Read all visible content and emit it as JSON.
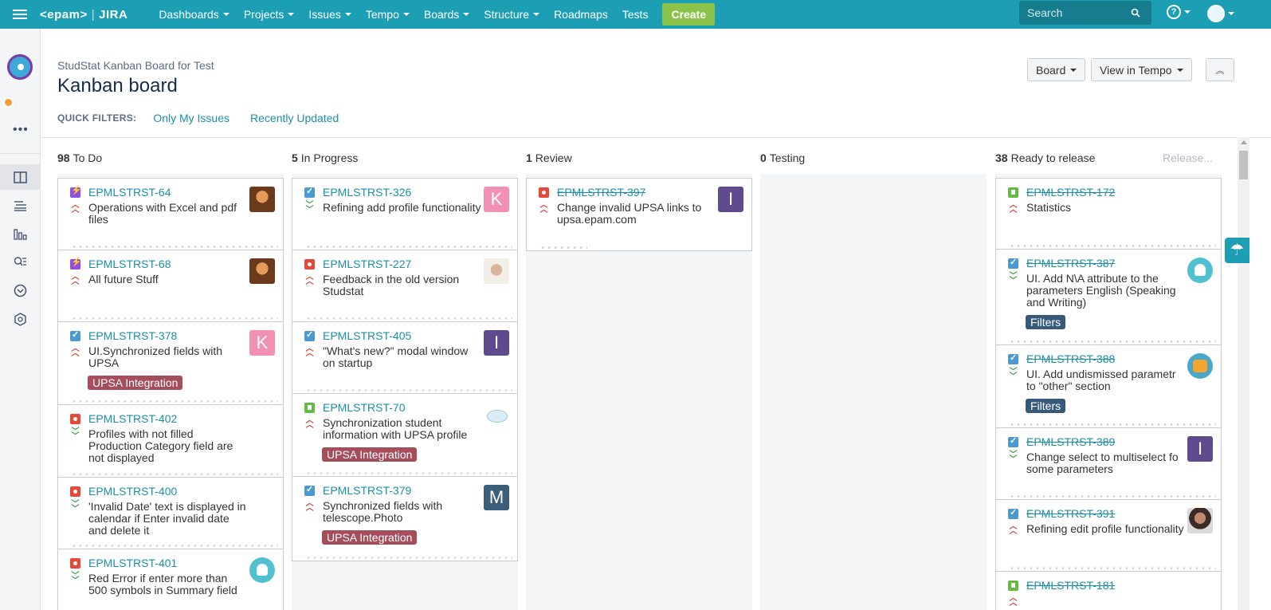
{
  "nav": {
    "logo_brand": "<epam>",
    "logo_sep": "|",
    "logo_product": "JIRA",
    "items": [
      {
        "label": "Dashboards",
        "caret": true
      },
      {
        "label": "Projects",
        "caret": true
      },
      {
        "label": "Issues",
        "caret": true
      },
      {
        "label": "Tempo",
        "caret": true
      },
      {
        "label": "Boards",
        "caret": true
      },
      {
        "label": "Structure",
        "caret": true
      },
      {
        "label": "Roadmaps",
        "caret": false
      },
      {
        "label": "Tests",
        "caret": false
      }
    ],
    "create_label": "Create",
    "search_placeholder": "Search",
    "help_label": "?"
  },
  "sidebar": {
    "more_label": "•••",
    "icons": [
      "board-icon",
      "backlog-icon",
      "reports-icon",
      "issues-search-icon",
      "releases-icon",
      "components-icon"
    ],
    "expand_label": "»"
  },
  "header": {
    "project_name": "StudStat Kanban Board for Test",
    "title": "Kanban board",
    "quick_filters_label": "QUICK FILTERS:",
    "quick_filters": [
      "Only My Issues",
      "Recently Updated"
    ],
    "board_button": "Board",
    "tempo_button": "View in Tempo",
    "collapse_label": "︽"
  },
  "columns": [
    {
      "count": "98",
      "name": "To Do"
    },
    {
      "count": "5",
      "name": "In Progress"
    },
    {
      "count": "1",
      "name": "Review"
    },
    {
      "count": "0",
      "name": "Testing"
    },
    {
      "count": "38",
      "name": "Ready to release"
    }
  ],
  "release_label": "Release...",
  "cards": {
    "todo": [
      {
        "type": "epic",
        "key": "EPMLSTRST-64",
        "prio": "high",
        "summary": "Operations with Excel and pdf files",
        "avatar": "photo1",
        "avatar_text": ""
      },
      {
        "type": "epic",
        "key": "EPMLSTRST-68",
        "prio": "high",
        "summary": "All future Stuff",
        "avatar": "photo1",
        "avatar_text": ""
      },
      {
        "type": "task",
        "key": "EPMLSTRST-378",
        "prio": "high",
        "summary": "UI.Synchronized fields with UPSA",
        "avatar": "k",
        "avatar_text": "K",
        "label": "UPSA Integration"
      },
      {
        "type": "bug",
        "key": "EPMLSTRST-402",
        "prio": "low",
        "summary": "Profiles with not filled Production Category field are not displayed",
        "avatar": "",
        "avatar_text": ""
      },
      {
        "type": "bug",
        "key": "EPMLSTRST-400",
        "prio": "low",
        "summary": "'Invalid Date' text is displayed in calendar if Enter invalid date and delete it",
        "avatar": "",
        "avatar_text": ""
      },
      {
        "type": "bug",
        "key": "EPMLSTRST-401",
        "prio": "low",
        "summary": "Red Error if enter more than 500 symbols in Summary field",
        "avatar": "round",
        "avatar_text": ""
      }
    ],
    "progress": [
      {
        "type": "task",
        "key": "EPMLSTRST-326",
        "prio": "low",
        "summary": "Refining add profile functionality",
        "avatar": "k",
        "avatar_text": "K"
      },
      {
        "type": "bug",
        "key": "EPMLSTRST-227",
        "prio": "high",
        "summary": "Feedback in the old version Studstat",
        "avatar": "photo2",
        "avatar_text": ""
      },
      {
        "type": "task",
        "key": "EPMLSTRST-405",
        "prio": "high",
        "summary": "\"What's new?\" modal window on startup",
        "avatar": "i",
        "avatar_text": "I"
      },
      {
        "type": "story",
        "key": "EPMLSTRST-70",
        "prio": "high",
        "summary": "Synchronization student information with UPSA profile",
        "avatar": "fish",
        "avatar_text": "",
        "label": "UPSA Integration"
      },
      {
        "type": "task",
        "key": "EPMLSTRST-379",
        "prio": "high",
        "summary": "Synchronized fields with telescope.Photo",
        "avatar": "m",
        "avatar_text": "M",
        "label": "UPSA Integration"
      }
    ],
    "review": [
      {
        "type": "bug",
        "key": "EPMLSTRST-397",
        "prio": "high",
        "summary": "Change invalid UPSA links to upsa.epam.com",
        "avatar": "i",
        "avatar_text": "I",
        "done": true
      }
    ],
    "release": [
      {
        "type": "story",
        "key": "EPMLSTRST-172",
        "prio": "high",
        "summary": "Statistics",
        "avatar": "",
        "avatar_text": "",
        "done": true
      },
      {
        "type": "task",
        "key": "EPMLSTRST-387",
        "prio": "low",
        "summary": "UI. Add N\\A attribute to the parameters English (Speaking and Writing)",
        "avatar": "round",
        "avatar_text": "",
        "done": true,
        "label": "Filters"
      },
      {
        "type": "task",
        "key": "EPMLSTRST-388",
        "prio": "low",
        "summary": "UI. Add undismissed parametr to \"other\" section",
        "avatar": "cat",
        "avatar_text": "",
        "done": true,
        "label": "Filters"
      },
      {
        "type": "task",
        "key": "EPMLSTRST-389",
        "prio": "low",
        "summary": "Change select to multiselect fo some parameters",
        "avatar": "i",
        "avatar_text": "I",
        "done": true
      },
      {
        "type": "task",
        "key": "EPMLSTRST-391",
        "prio": "high",
        "summary": "Refining edit profile functionality",
        "avatar": "photo3",
        "avatar_text": "",
        "done": true
      },
      {
        "type": "story",
        "key": "EPMLSTRST-181",
        "prio": "high",
        "summary": "",
        "avatar": "",
        "avatar_text": "",
        "done": true
      }
    ]
  },
  "colors": {
    "nav": "#1c9eb5",
    "create": "#8bc34a",
    "link": "#1c8fa8",
    "epic_label": "#a64d5b",
    "filters_label": "#385a7a"
  }
}
